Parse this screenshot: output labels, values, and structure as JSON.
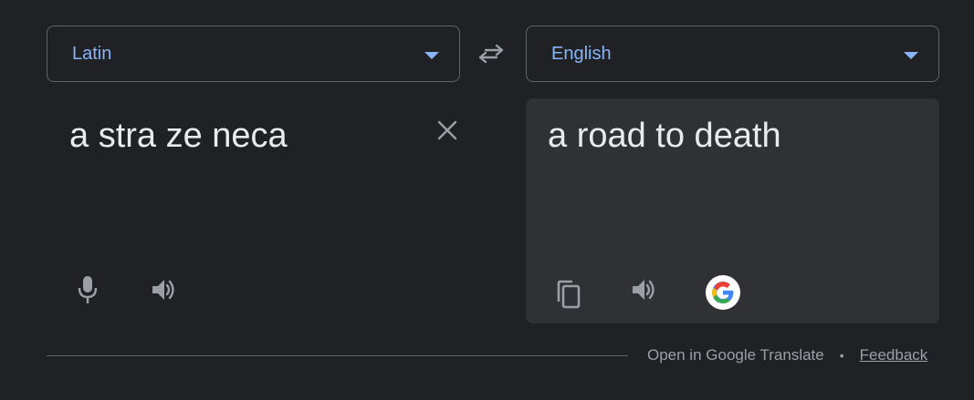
{
  "source": {
    "language": "Latin",
    "text": "a stra ze neca"
  },
  "target": {
    "language": "English",
    "text": "a road to death"
  },
  "footer": {
    "open_link": "Open in Google Translate",
    "separator": "•",
    "feedback": "Feedback"
  },
  "icons": {
    "swap": "swap-languages-icon",
    "clear": "close-icon",
    "mic": "microphone-icon",
    "speaker": "speaker-icon",
    "copy": "copy-icon",
    "google": "google-logo-icon"
  },
  "colors": {
    "background": "#202124",
    "accent": "#8ab4f8",
    "output_panel": "#303134",
    "text": "#e8eaed",
    "muted": "#9aa0a6"
  }
}
